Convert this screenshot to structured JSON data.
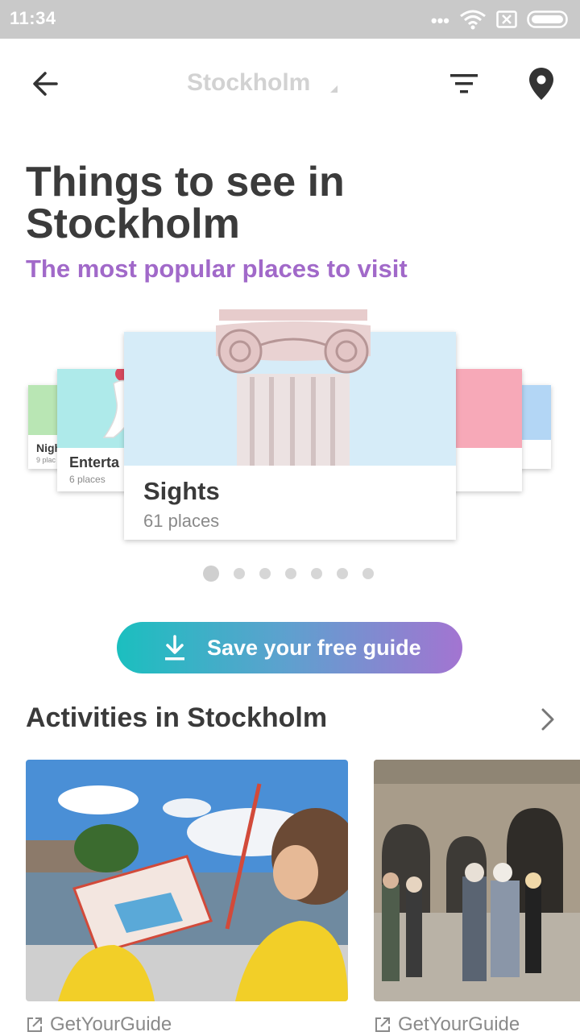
{
  "status_bar": {
    "time": "11:34",
    "signal_dots": "•••"
  },
  "app_bar": {
    "city": "Stockholm"
  },
  "hero": {
    "title": "Things to see in Stockholm",
    "subtitle": "The most popular places to visit"
  },
  "carousel": {
    "cards": [
      {
        "label": "Nigh",
        "count": "9 plac"
      },
      {
        "label": "Enterta",
        "count": "6 places"
      },
      {
        "label": "Sights",
        "count": "61 places"
      }
    ],
    "page_count": 7,
    "active_index": 0
  },
  "save_button": {
    "label": "Save your free guide"
  },
  "activities": {
    "title": "Activities in Stockholm",
    "items": [
      {
        "provider": "GetYourGuide"
      },
      {
        "provider": "GetYourGuide"
      }
    ]
  },
  "colors": {
    "accent_purple": "#a169c9",
    "gradient_start": "#1bbfbf",
    "gradient_end": "#a374d1",
    "title_gray": "#3b3b3b"
  }
}
